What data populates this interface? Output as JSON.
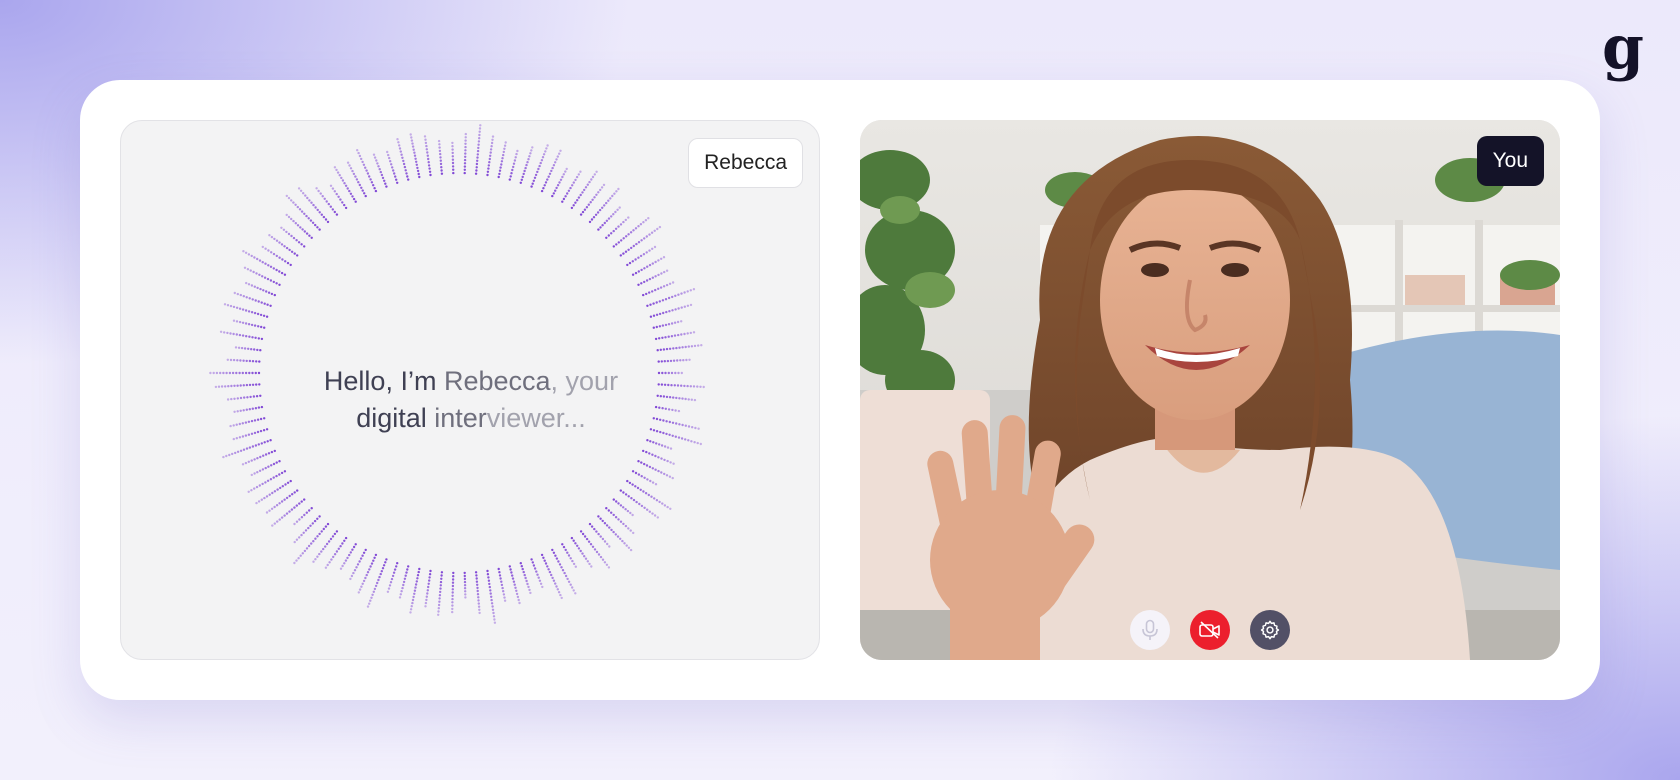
{
  "brand": {
    "logo_text": "g"
  },
  "agent_panel": {
    "name": "Rebecca",
    "greeting_parts": [
      "Hello, I’m ",
      "Rebecca",
      ", your",
      "digital ",
      "inter",
      "viewer..."
    ],
    "wave_color": "#7b3fd4"
  },
  "user_panel": {
    "name": "You",
    "controls": [
      {
        "icon": "microphone-icon",
        "state": "disabled"
      },
      {
        "icon": "camera-off-icon",
        "state": "off",
        "color": "#ec1f2d"
      },
      {
        "icon": "gear-icon",
        "color": "#525066"
      }
    ]
  },
  "colors": {
    "accent": "#7b3fd4",
    "tag_dark": "#141328",
    "danger": "#ec1f2d"
  }
}
